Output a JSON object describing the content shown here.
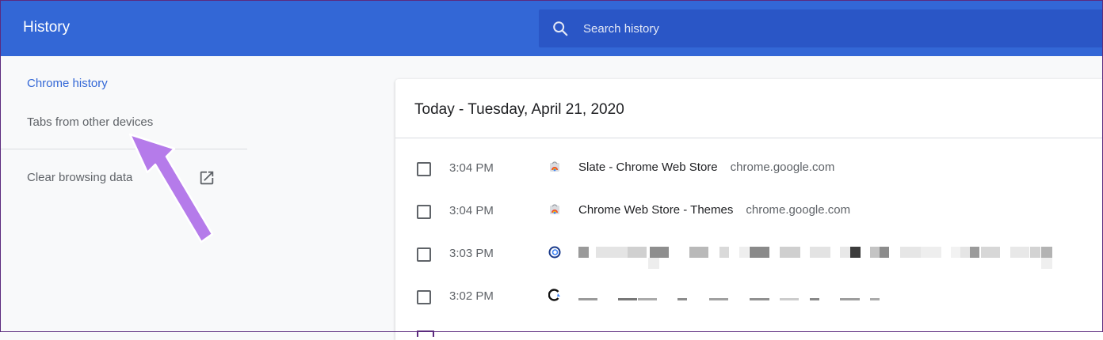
{
  "header": {
    "title": "History"
  },
  "search": {
    "placeholder": "Search history"
  },
  "sidebar": {
    "items": [
      {
        "label": "Chrome history"
      },
      {
        "label": "Tabs from other devices"
      },
      {
        "label": "Clear browsing data"
      }
    ]
  },
  "main": {
    "date_heading": "Today - Tuesday, April 21, 2020",
    "entries": [
      {
        "time": "3:04 PM",
        "title": "Slate - Chrome Web Store",
        "domain": "chrome.google.com"
      },
      {
        "time": "3:04 PM",
        "title": "Chrome Web Store - Themes",
        "domain": "chrome.google.com"
      },
      {
        "time": "3:03 PM"
      },
      {
        "time": "3:02 PM"
      }
    ]
  },
  "colors": {
    "header": "#3367d6",
    "search_bg": "#2a56c6",
    "accent": "#3367d6",
    "annotation_arrow": "#b57bea"
  }
}
